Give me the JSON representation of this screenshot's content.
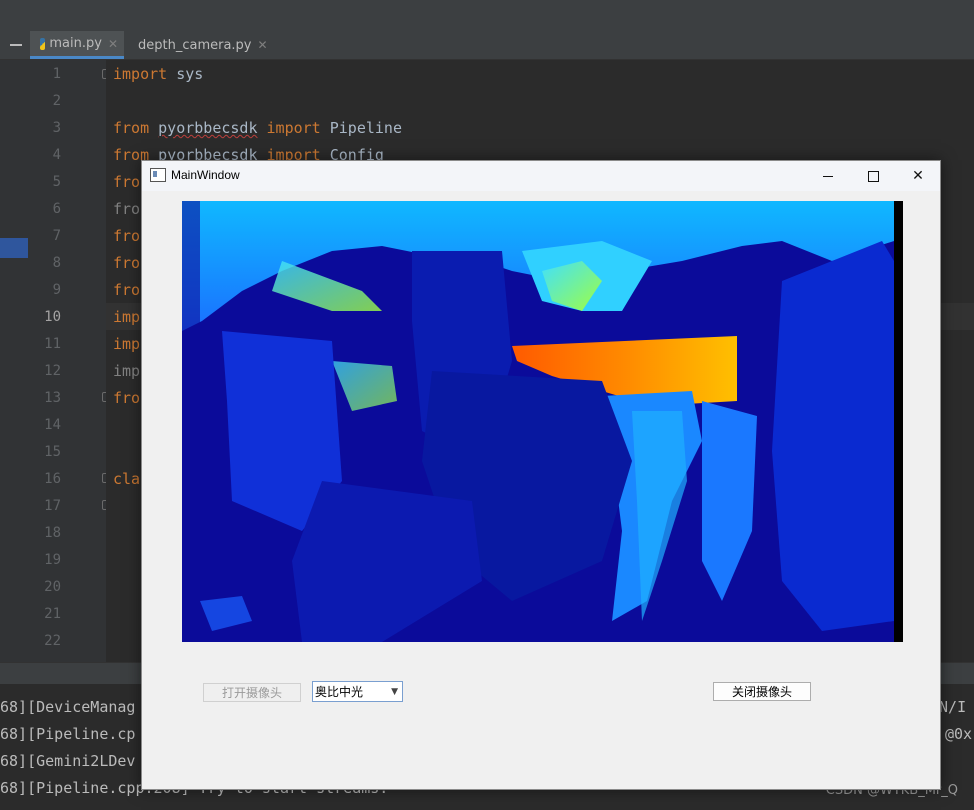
{
  "tabs": [
    {
      "label": "main.py",
      "active": true
    },
    {
      "label": "depth_camera.py",
      "active": false
    }
  ],
  "line_numbers": [
    "1",
    "2",
    "3",
    "4",
    "5",
    "6",
    "7",
    "8",
    "9",
    "10",
    "11",
    "12",
    "13",
    "14",
    "15",
    "16",
    "17",
    "18",
    "19",
    "20",
    "21",
    "22"
  ],
  "current_line": "10",
  "code": {
    "l1_kw": "import",
    "l1_rest": " sys",
    "l3_kw": "from",
    "l3_mod": "pyorbbecsdk",
    "l3_kw2": "import",
    "l3_rest": " Pipeline",
    "l4_kw": "from",
    "l4_mod": "pyorbbecsdk",
    "l4_kw2": "import",
    "l4_rest": " Config",
    "l5": "fro",
    "l6": "fro",
    "l7": "fro",
    "l8": "fro",
    "l9": "fro",
    "l10": "imp",
    "l11": "imp",
    "l12": "imp",
    "l13": "fro",
    "l16": "cla"
  },
  "console": {
    "lines": [
      {
        "left": "68][DeviceManag",
        "right": "SN/I"
      },
      {
        "left": "68][Pipeline.cp",
        "right": "@0x"
      },
      {
        "left": "68][Gemini2LDev",
        "right": ""
      },
      {
        "left": "68][Pipeline.cpp:208] Try to start streams.",
        "right": ""
      }
    ]
  },
  "watermark": "CSDN @WYKB_Mr_Q",
  "window": {
    "title": "MainWindow",
    "open_button": "打开摄像头",
    "open_enabled": false,
    "device_combo_value": "奥比中光",
    "close_button": "关闭摄像头",
    "minimize_glyph": "—",
    "close_glyph": "✕"
  },
  "colors": {
    "editor_bg": "#2b2b2b",
    "keyword": "#cc7832",
    "identifier": "#a9b7c6",
    "depth_far": "#00ffff",
    "depth_near": "#0000b0",
    "depth_hot": "#ff6a00"
  }
}
